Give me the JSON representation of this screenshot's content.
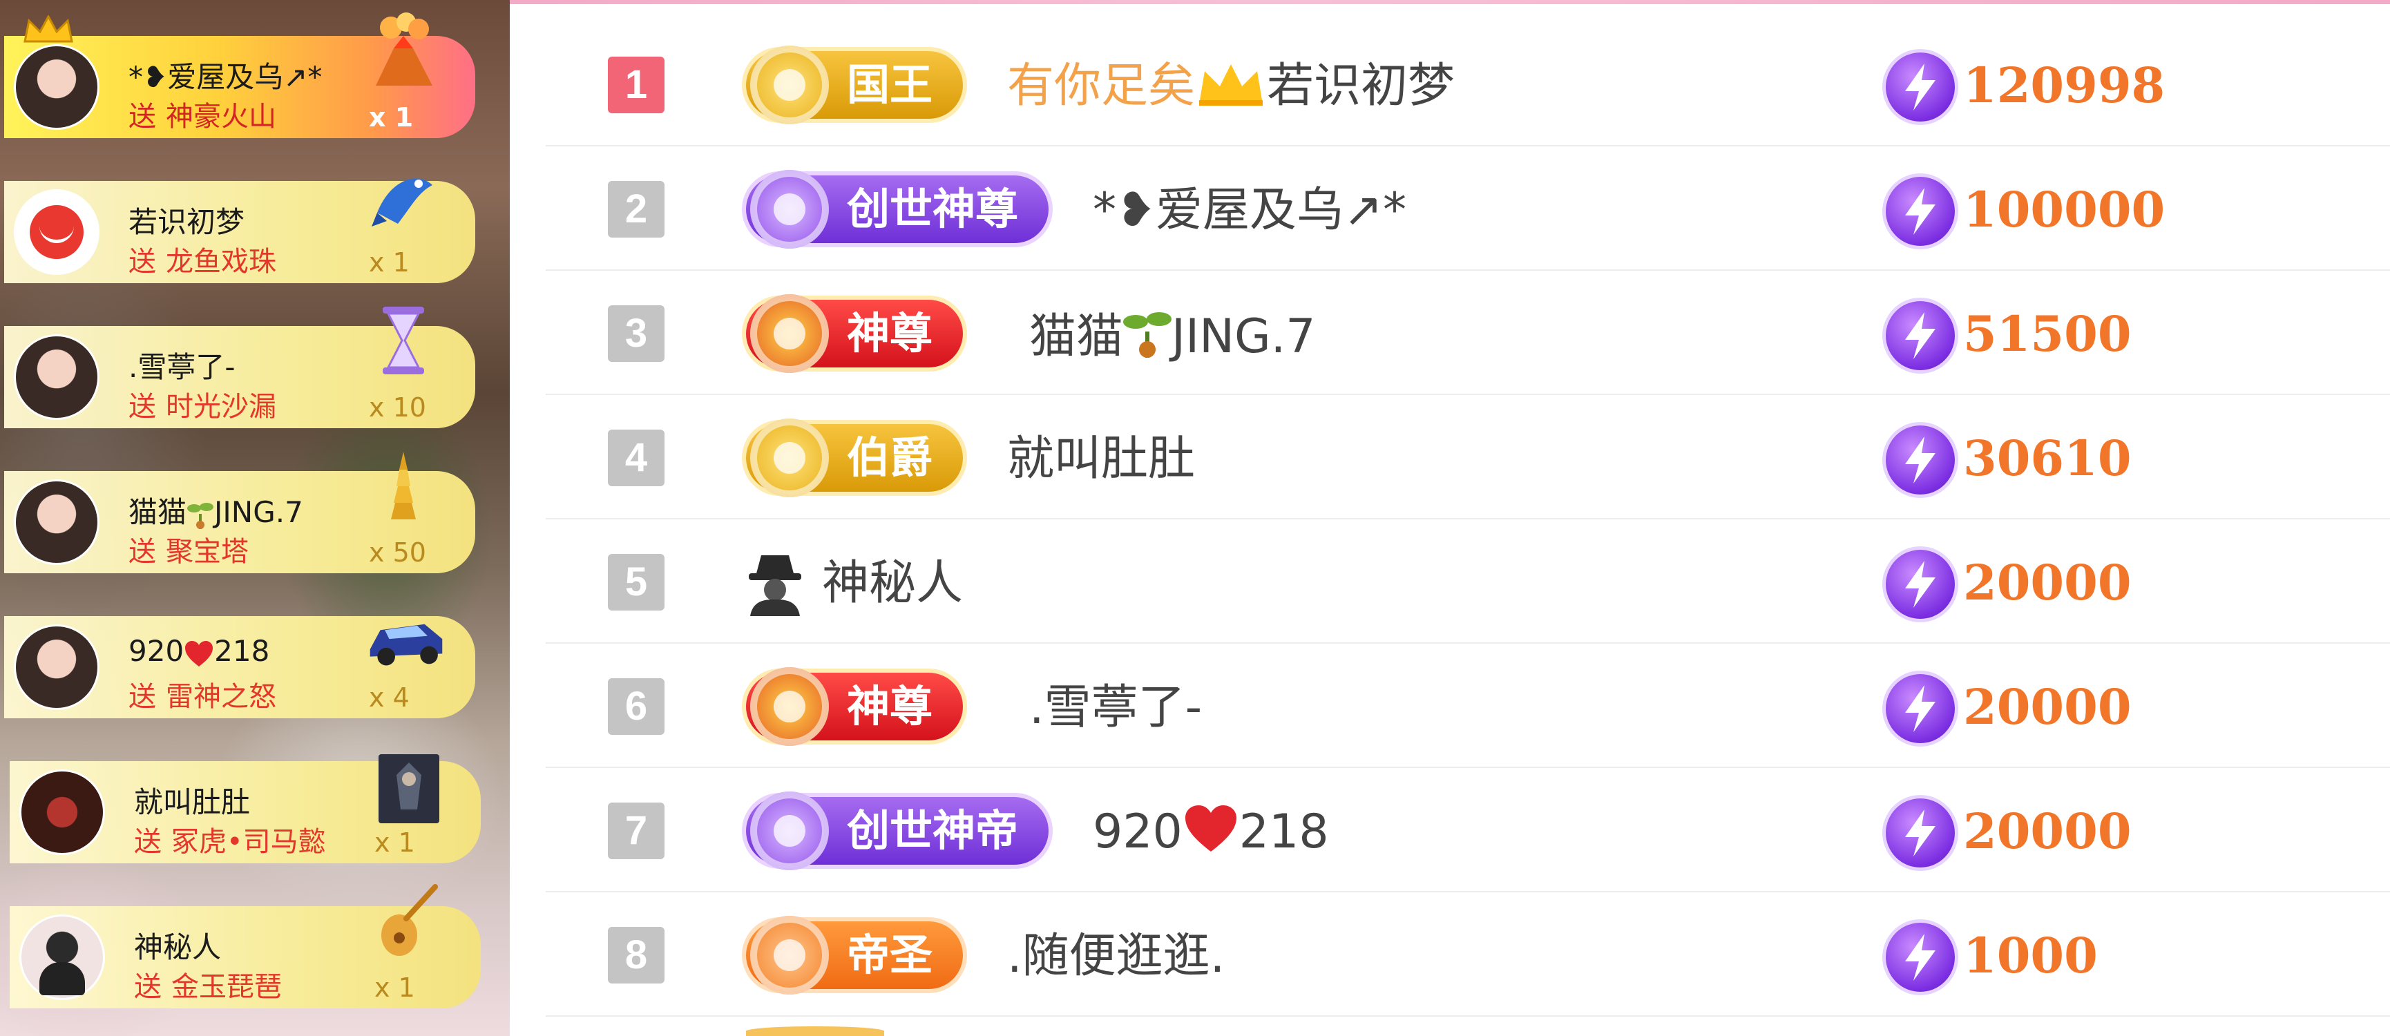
{
  "gift_feed": [
    {
      "user": "*❥爱屋及乌↗*",
      "action": "送",
      "gift": "神豪火山",
      "count": "x 1",
      "highlight": true
    },
    {
      "user": "若识初梦",
      "action": "送",
      "gift": "龙鱼戏珠",
      "count": "x 1"
    },
    {
      "user": ".雪葶了-",
      "action": "送",
      "gift": "时光沙漏",
      "count": "x 10"
    },
    {
      "user_before": "猫猫",
      "user_after": "JING.7",
      "action": "送",
      "gift": "聚宝塔",
      "count": "x 50"
    },
    {
      "user_before": "920",
      "user_after": "218",
      "action": "送",
      "gift": "雷神之怒",
      "count": "x 4"
    },
    {
      "user": "就叫肚肚",
      "action": "送",
      "gift": "冢虎•司马懿",
      "count": "x 1"
    },
    {
      "user": "神秘人",
      "action": "送",
      "gift": "金玉琵琶",
      "count": "x 1"
    }
  ],
  "ranking": [
    {
      "rank": "1",
      "badge": "国王",
      "name_highlight": "有你足矣",
      "name": "若识初梦",
      "score": "120998"
    },
    {
      "rank": "2",
      "badge": "创世神尊",
      "name": "*❥爱屋及乌↗*",
      "score": "100000"
    },
    {
      "rank": "3",
      "badge": "神尊",
      "name_before": "猫猫",
      "name_after": "JING.7",
      "score": "51500"
    },
    {
      "rank": "4",
      "badge": "伯爵",
      "name": "就叫肚肚",
      "score": "30610"
    },
    {
      "rank": "5",
      "name": "神秘人",
      "score": "20000"
    },
    {
      "rank": "6",
      "badge": "神尊",
      "name": ".雪葶了-",
      "score": "20000"
    },
    {
      "rank": "7",
      "badge": "创世神帝",
      "name_before": "920",
      "name_after": "218",
      "score": "20000"
    },
    {
      "rank": "8",
      "badge": "帝圣",
      "name": ".随便逛逛.",
      "score": "1000"
    }
  ],
  "icons": {
    "score_icon": "lightning-icon",
    "crown": "crown-icon",
    "sprout": "sprout-icon",
    "heart": "heart-icon",
    "incognito": "incognito-icon"
  },
  "colors": {
    "rank_first": "#f16576",
    "rank_other": "#c4c4c4",
    "score_text": "#f1762a",
    "name_highlight": "#f3a24a",
    "gift_text": "#e4372c"
  }
}
